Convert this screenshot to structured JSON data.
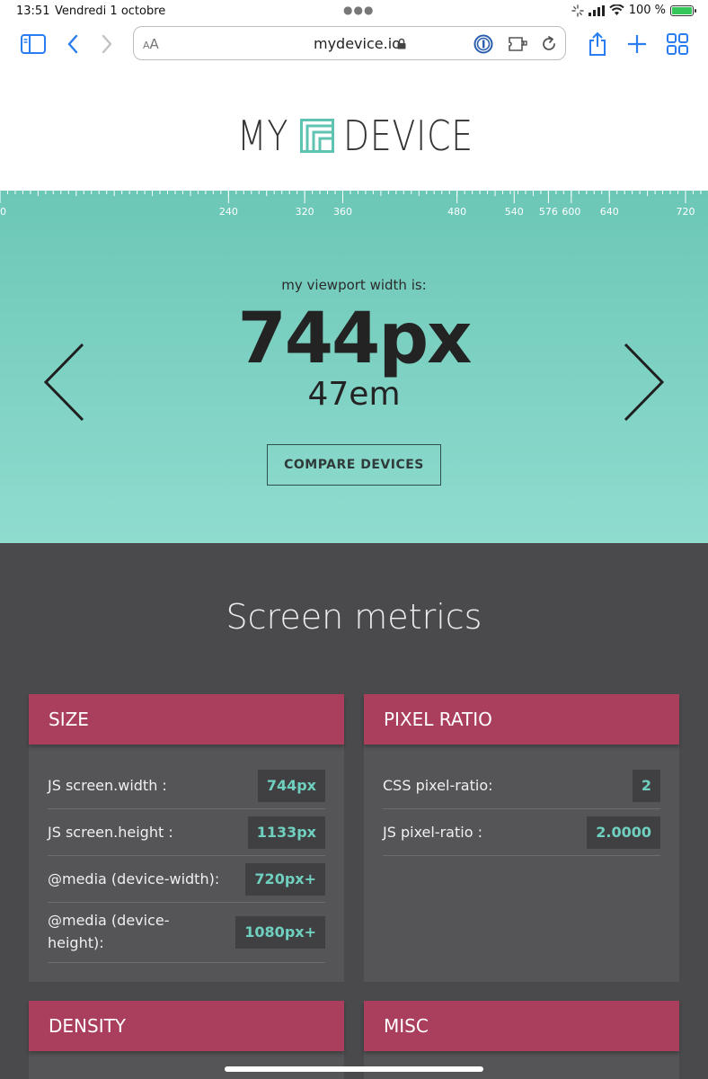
{
  "status_bar": {
    "time": "13:51",
    "date": "Vendredi 1 octobre",
    "battery": "100 %"
  },
  "toolbar": {
    "text_size": "AA",
    "url": "mydevice.io"
  },
  "logo": {
    "left": "MY",
    "right": "DEVICE"
  },
  "ruler": {
    "labels": [
      "0",
      "240",
      "320",
      "360",
      "480",
      "540",
      "576",
      "600",
      "640",
      "720"
    ]
  },
  "hero": {
    "label": "my viewport width is:",
    "width_px": "744px",
    "width_em": "47em",
    "compare_button": "COMPARE DEVICES"
  },
  "metrics": {
    "title": "Screen metrics",
    "cards": [
      {
        "title": "SIZE",
        "rows": [
          {
            "label": "JS screen.width :",
            "value": "744px"
          },
          {
            "label": "JS screen.height :",
            "value": "1133px"
          },
          {
            "label": "@media (device-width):",
            "value": "720px+"
          },
          {
            "label": "@media (device-height):",
            "value": "1080px+"
          }
        ]
      },
      {
        "title": "PIXEL RATIO",
        "rows": [
          {
            "label": "CSS pixel-ratio:",
            "value": "2"
          },
          {
            "label": "JS pixel-ratio :",
            "value": "2.0000"
          }
        ]
      },
      {
        "title": "DENSITY",
        "rows": []
      },
      {
        "title": "MISC",
        "rows": []
      }
    ]
  }
}
